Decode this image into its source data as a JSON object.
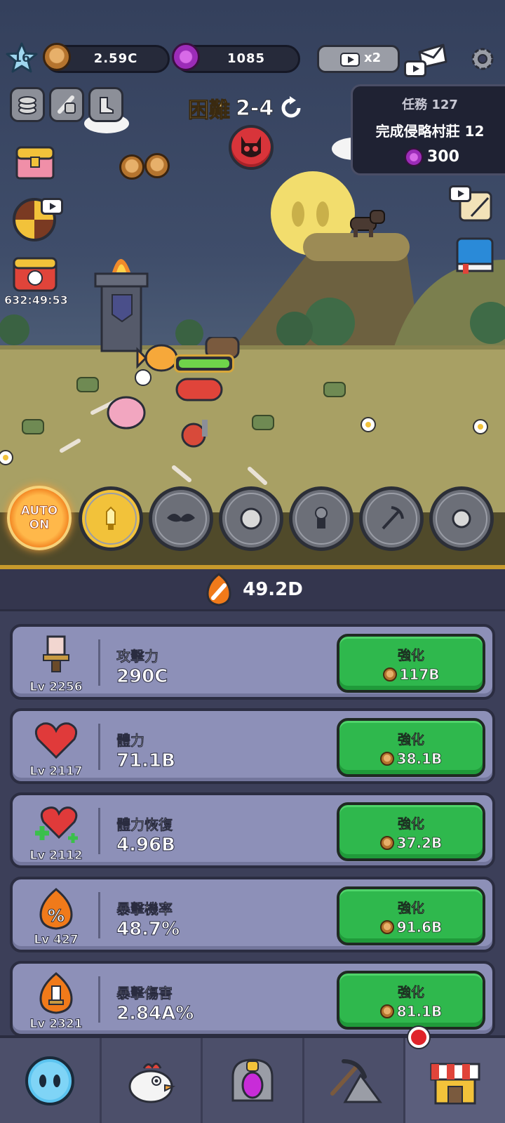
{
  "hud": {
    "level": "16",
    "coins": "2.59C",
    "gems": "1085",
    "ad_multiplier": "x2",
    "timer": "632:49:53"
  },
  "stage": {
    "difficulty": "困難",
    "number": "2-4"
  },
  "quest": {
    "title": "任務 127",
    "description": "完成侵略村莊 12",
    "reward": "300"
  },
  "skills": {
    "auto_line1": "AUTO",
    "auto_line2": "ON"
  },
  "power": {
    "value": "49.2D"
  },
  "stats": [
    {
      "name": "攻擊力",
      "level": "Lv 2256",
      "value": "290C",
      "button": "強化",
      "cost": "117B",
      "icon": "sword-icon"
    },
    {
      "name": "體力",
      "level": "Lv 2117",
      "value": "71.1B",
      "button": "強化",
      "cost": "38.1B",
      "icon": "heart-icon"
    },
    {
      "name": "體力恢復",
      "level": "Lv 2112",
      "value": "4.96B",
      "button": "強化",
      "cost": "37.2B",
      "icon": "heart-plus-icon"
    },
    {
      "name": "暴擊機率",
      "level": "Lv 427",
      "value": "48.7%",
      "button": "強化",
      "cost": "91.6B",
      "icon": "crit-percent-icon"
    },
    {
      "name": "暴擊傷害",
      "level": "Lv 2321",
      "value": "2.84A%",
      "button": "強化",
      "cost": "81.1B",
      "icon": "crit-sword-icon"
    }
  ],
  "colors": {
    "upgrade_green": "#2fb84d",
    "card_bg": "#8d90b8",
    "panel_bg": "#3c3f59",
    "gold_border": "#c79a2c",
    "gem_purple": "#b02cc9"
  },
  "nav": [
    "character-icon",
    "chicken-pet-icon",
    "portal-icon",
    "mining-icon",
    "shop-icon"
  ]
}
